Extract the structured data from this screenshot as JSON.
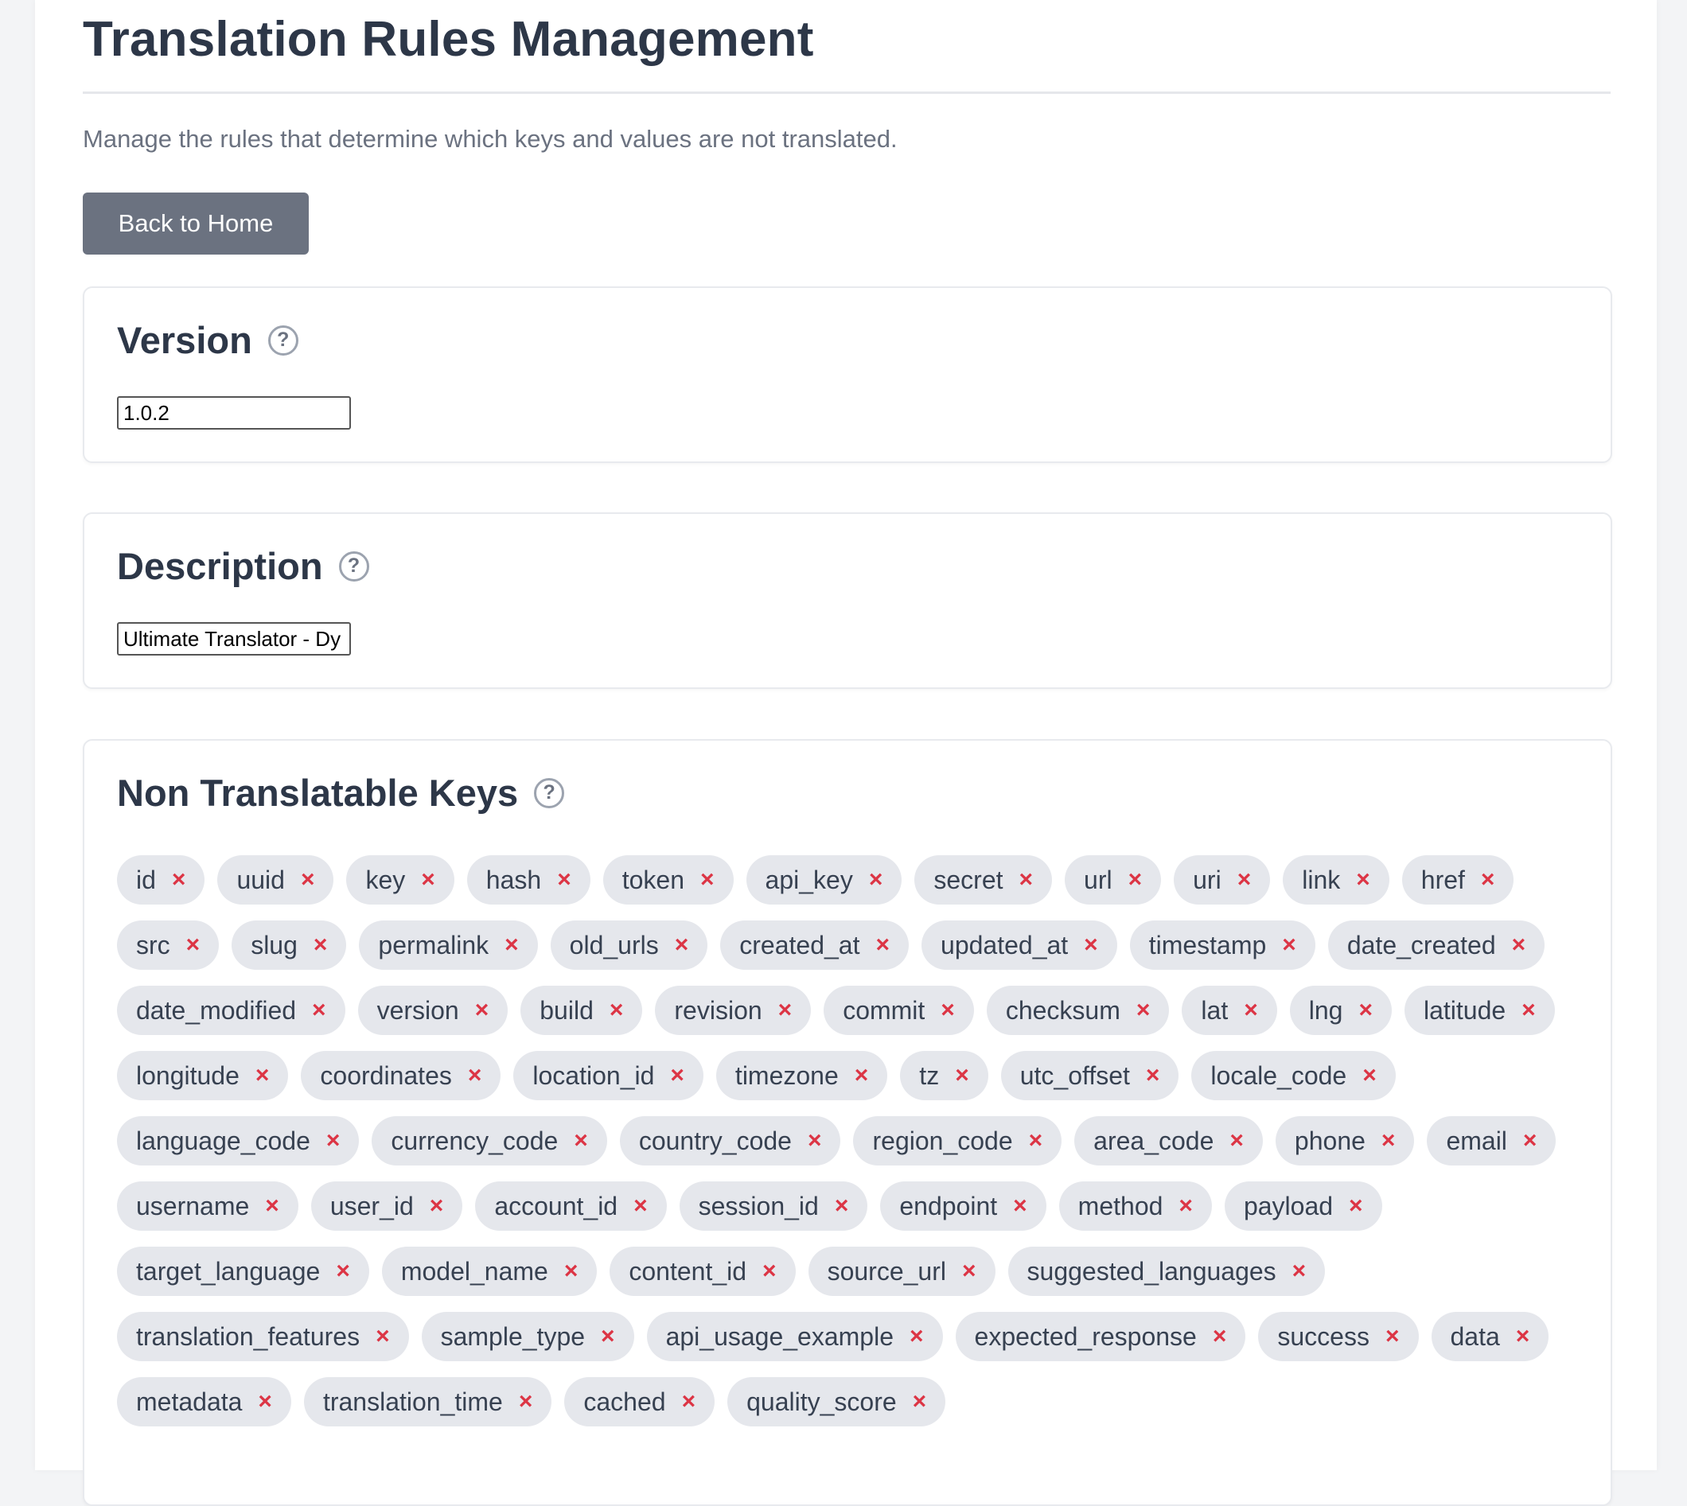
{
  "page": {
    "title": "Translation Rules Management",
    "subtitle": "Manage the rules that determine which keys and values are not translated.",
    "back_button": "Back to Home"
  },
  "version": {
    "heading": "Version",
    "help": "?",
    "value": "1.0.2"
  },
  "description": {
    "heading": "Description",
    "help": "?",
    "value": "Ultimate Translator - Dy"
  },
  "non_translatable_keys": {
    "heading": "Non Translatable Keys",
    "help": "?",
    "remove_glyph": "×",
    "tags": [
      "id",
      "uuid",
      "key",
      "hash",
      "token",
      "api_key",
      "secret",
      "url",
      "uri",
      "link",
      "href",
      "src",
      "slug",
      "permalink",
      "old_urls",
      "created_at",
      "updated_at",
      "timestamp",
      "date_created",
      "date_modified",
      "version",
      "build",
      "revision",
      "commit",
      "checksum",
      "lat",
      "lng",
      "latitude",
      "longitude",
      "coordinates",
      "location_id",
      "timezone",
      "tz",
      "utc_offset",
      "locale_code",
      "language_code",
      "currency_code",
      "country_code",
      "region_code",
      "area_code",
      "phone",
      "email",
      "username",
      "user_id",
      "account_id",
      "session_id",
      "endpoint",
      "method",
      "payload",
      "target_language",
      "model_name",
      "content_id",
      "source_url",
      "suggested_languages",
      "translation_features",
      "sample_type",
      "api_usage_example",
      "expected_response",
      "success",
      "data",
      "metadata",
      "translation_time",
      "cached",
      "quality_score"
    ]
  },
  "colors": {
    "remove_icon": "#dc3545",
    "tag_background": "#e5e7ec",
    "button_background": "#6b7280"
  }
}
